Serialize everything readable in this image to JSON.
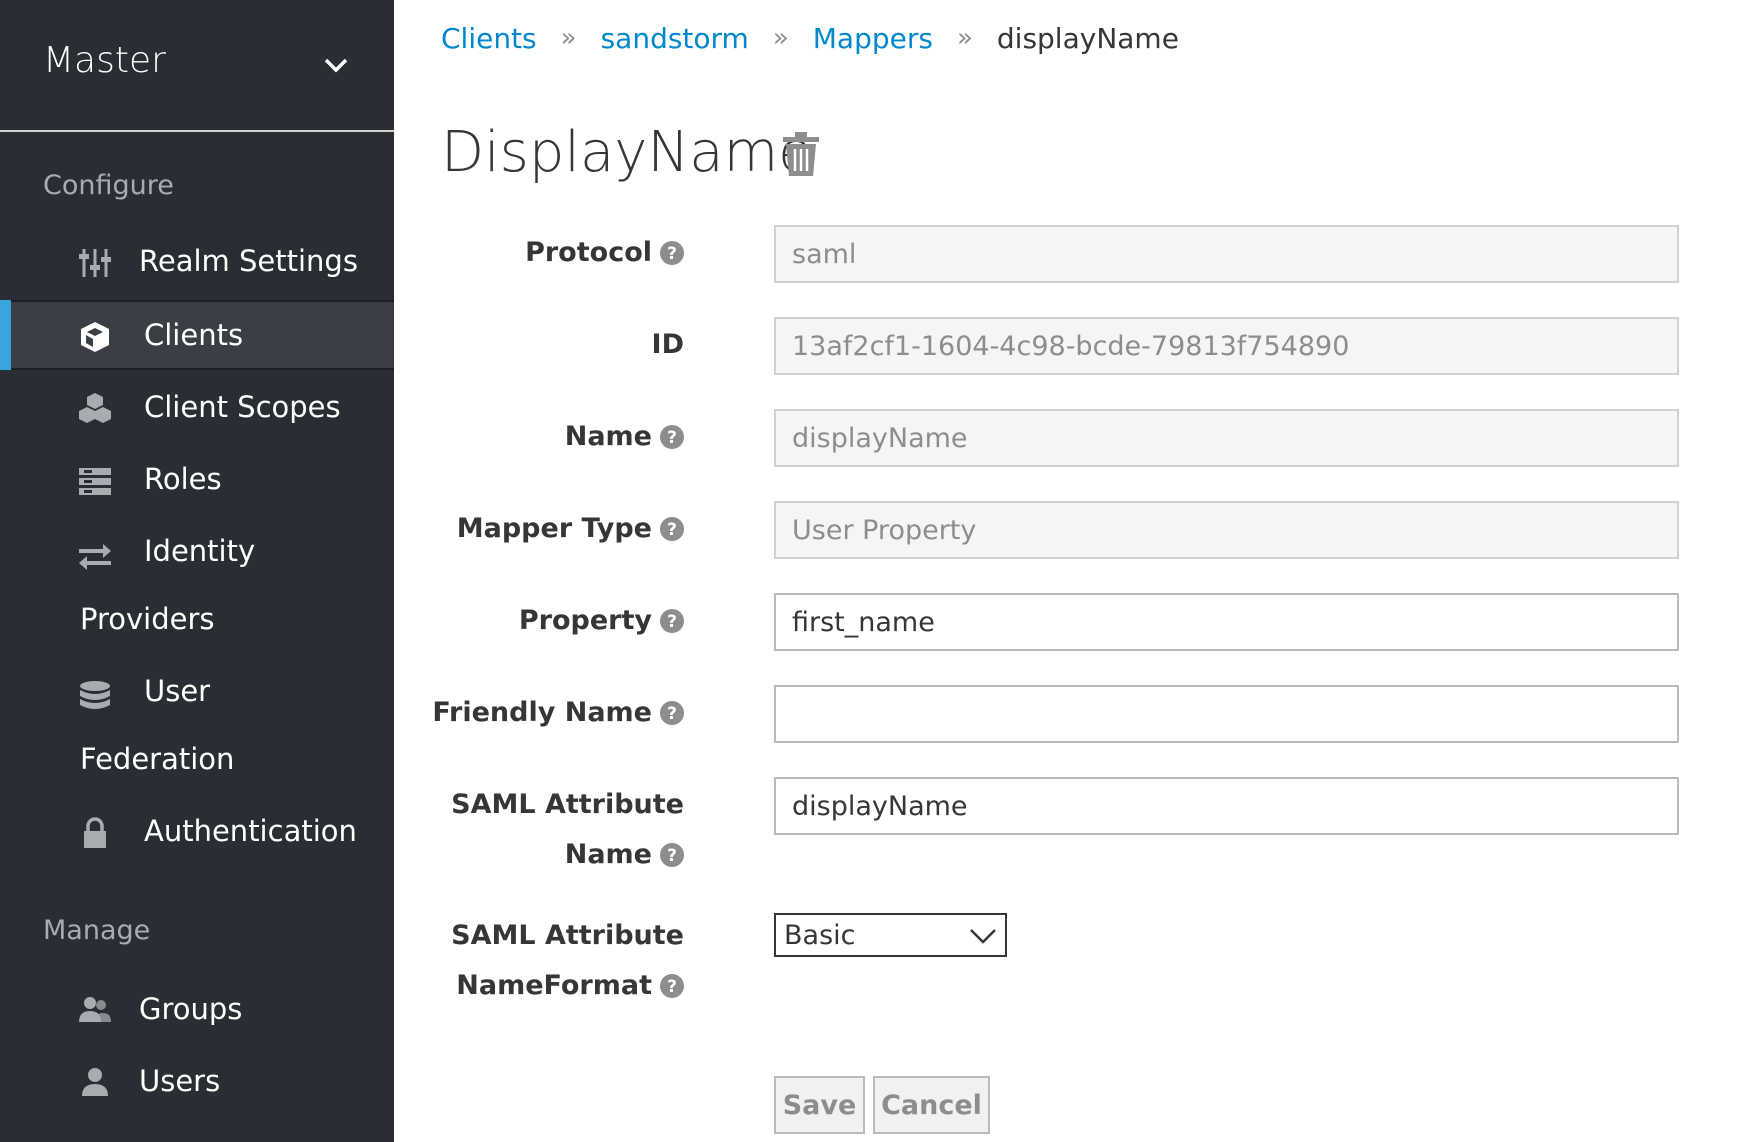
{
  "sidebar": {
    "realm": "Master",
    "configure_label": "Configure",
    "manage_label": "Manage",
    "items": {
      "realm_settings": "Realm Settings",
      "clients": "Clients",
      "client_scopes": "Client Scopes",
      "roles": "Roles",
      "identity_line1": "Identity",
      "identity_line2": "Providers",
      "user_fed_line1": "User",
      "user_fed_line2": "Federation",
      "authentication": "Authentication",
      "groups": "Groups",
      "users": "Users"
    }
  },
  "breadcrumb": {
    "clients": "Clients",
    "client": "sandstorm",
    "mappers": "Mappers",
    "current": "displayName",
    "separator": "»"
  },
  "page": {
    "title": "DisplayName"
  },
  "form": {
    "protocol": {
      "label": "Protocol",
      "value": "saml"
    },
    "id": {
      "label": "ID",
      "value": "13af2cf1-1604-4c98-bcde-79813f754890"
    },
    "name": {
      "label": "Name",
      "value": "displayName"
    },
    "mapper_type": {
      "label": "Mapper Type",
      "value": "User Property"
    },
    "property": {
      "label": "Property",
      "value": "first_name"
    },
    "friendly_name": {
      "label": "Friendly Name",
      "value": ""
    },
    "saml_attr_name": {
      "label_line1": "SAML Attribute",
      "label_line2": "Name",
      "value": "displayName"
    },
    "saml_attr_nameformat": {
      "label_line1": "SAML Attribute",
      "label_line2": "NameFormat",
      "value": "Basic"
    }
  },
  "buttons": {
    "save": "Save",
    "cancel": "Cancel"
  },
  "colors": {
    "sidebar_bg": "#292e34",
    "active_item_bg": "#393f44",
    "active_indicator": "#39a5dc",
    "link": "#0088ce"
  }
}
